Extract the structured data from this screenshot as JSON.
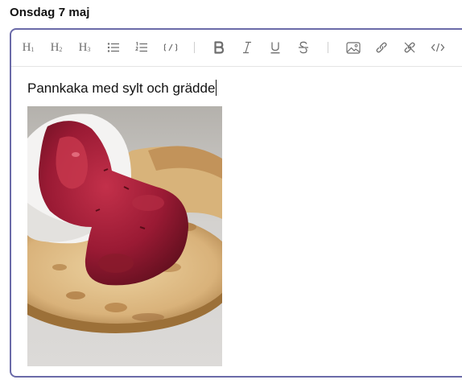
{
  "header": {
    "date": "Onsdag 7 maj"
  },
  "toolbar": {
    "h1": "H",
    "h1_sub": "1",
    "h2": "H",
    "h2_sub": "2",
    "h3": "H",
    "h3_sub": "3",
    "buttons": [
      "heading-1",
      "heading-2",
      "heading-3",
      "bullet-list",
      "numbered-list",
      "code-block",
      "bold",
      "italic",
      "underline",
      "strikethrough",
      "image",
      "link",
      "unlink",
      "code"
    ]
  },
  "editor": {
    "text": "Pannkaka med sylt och grädde",
    "image": {
      "subject": "pancake with jam and cream"
    }
  },
  "colors": {
    "border": "#6a6aa8",
    "icon": "#6e6e6e",
    "text": "#111111"
  }
}
